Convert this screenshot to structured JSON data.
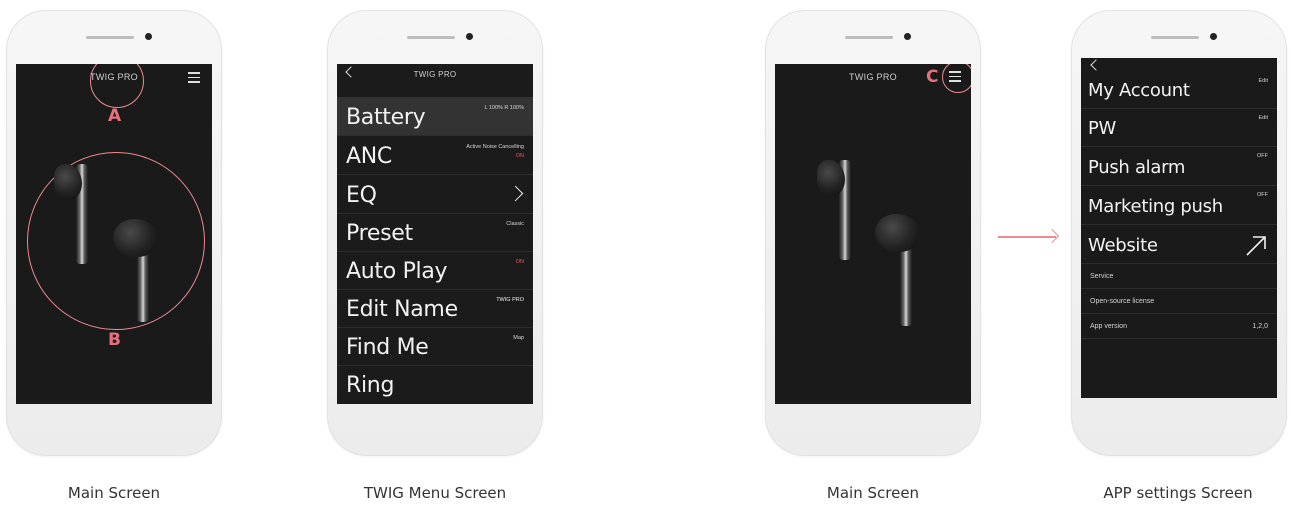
{
  "colors": {
    "accent": "#ef8a94",
    "screen_bg": "#1a1a1a",
    "on_red": "#e85b6a"
  },
  "screens": {
    "main1": {
      "title": "TWIG PRO",
      "marker_a": "A",
      "marker_b": "B",
      "caption": "Main Screen",
      "menu_icon": "hamburger-icon"
    },
    "menu": {
      "title": "TWIG PRO",
      "back_icon": "chevron-left-icon",
      "caption": "TWIG Menu Screen",
      "items": [
        {
          "label": "Battery",
          "value": "L 100%  R 100%"
        },
        {
          "label": "ANC",
          "value": "Active Noise Cancelling",
          "value2": "ON"
        },
        {
          "label": "EQ",
          "icon": "chevron-right-icon"
        },
        {
          "label": "Preset",
          "value": "Classic"
        },
        {
          "label": "Auto Play",
          "value": "ON"
        },
        {
          "label": "Edit Name",
          "value": "TWIG PRO"
        },
        {
          "label": "Find Me",
          "value": "Map"
        },
        {
          "label": "Ring"
        }
      ]
    },
    "main2": {
      "title": "TWIG PRO",
      "marker_c": "C",
      "caption": "Main Screen",
      "menu_icon": "hamburger-icon"
    },
    "settings": {
      "caption": "APP settings Screen",
      "back_icon": "chevron-left-icon",
      "items": [
        {
          "label": "My Account",
          "value": "Edit"
        },
        {
          "label": "PW",
          "value": "Edit"
        },
        {
          "label": "Push alarm",
          "value": "OFF"
        },
        {
          "label": "Marketing push",
          "value": "OFF"
        },
        {
          "label": "Website",
          "icon": "external-link-arrow-icon"
        }
      ],
      "small_items": [
        {
          "label": "Service"
        },
        {
          "label": "Open-source license"
        },
        {
          "label": "App version",
          "value": "1,2,0"
        }
      ]
    }
  },
  "flow_arrow_icon": "right-arrow-icon"
}
